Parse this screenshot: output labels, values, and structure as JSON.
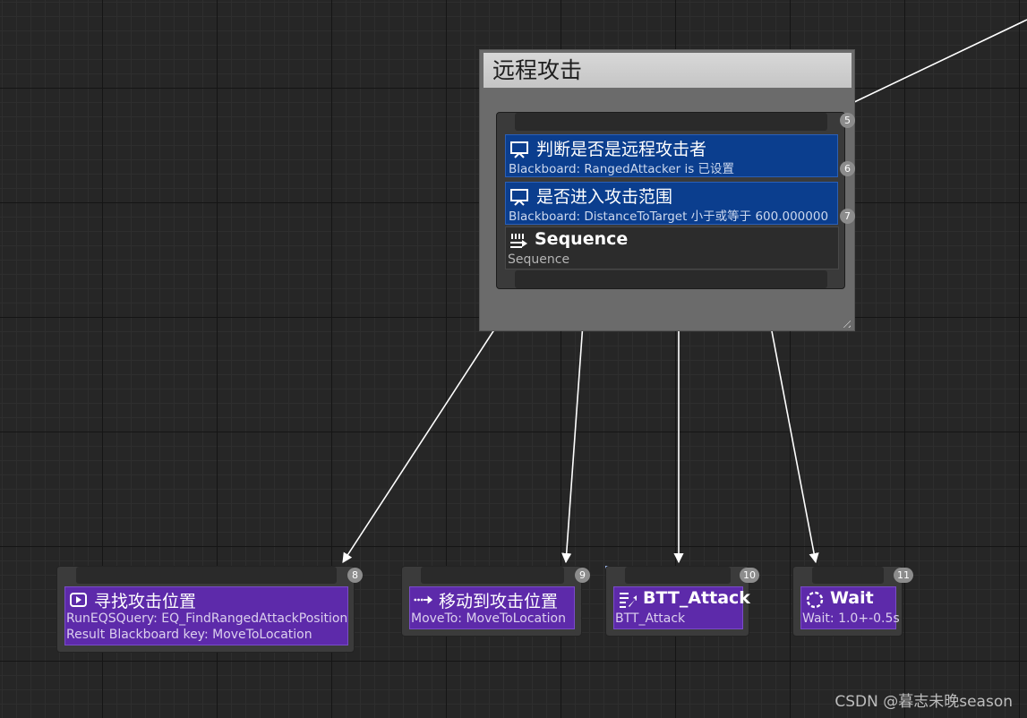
{
  "comment": {
    "title": "远程攻击"
  },
  "composite": {
    "index": "5",
    "decorators": [
      {
        "title": "判断是否是远程攻击者",
        "subtitle": "Blackboard: RangedAttacker is 已设置",
        "index": "6",
        "icon": "blackboard-decorator-icon"
      },
      {
        "title": "是否进入攻击范围",
        "subtitle": "Blackboard: DistanceToTarget 小于或等于 600.000000",
        "index": "7",
        "icon": "blackboard-decorator-icon"
      }
    ],
    "node": {
      "title": "Sequence",
      "subtitle": "Sequence",
      "icon": "sequence-icon"
    }
  },
  "tasks": [
    {
      "title": "寻找攻击位置",
      "sub1": "RunEQSQuery: EQ_FindRangedAttackPosition",
      "sub2": "Result Blackboard key: MoveToLocation",
      "index": "8",
      "icon": "eqs-query-icon"
    },
    {
      "title": "移动到攻击位置",
      "sub1": "MoveTo: MoveToLocation",
      "index": "9",
      "icon": "move-to-icon"
    },
    {
      "title": "BTT_Attack",
      "sub1": "BTT_Attack",
      "index": "10",
      "icon": "blueprint-task-icon"
    },
    {
      "title": "Wait",
      "sub1": "Wait: 1.0+-0.5s",
      "index": "11",
      "icon": "wait-icon"
    }
  ],
  "watermark": "CSDN @暮志未晚season",
  "colors": {
    "decorator": "#0b3e8e",
    "task": "#5d2aaa",
    "comment": "#6b6b6b",
    "background": "#262626"
  }
}
